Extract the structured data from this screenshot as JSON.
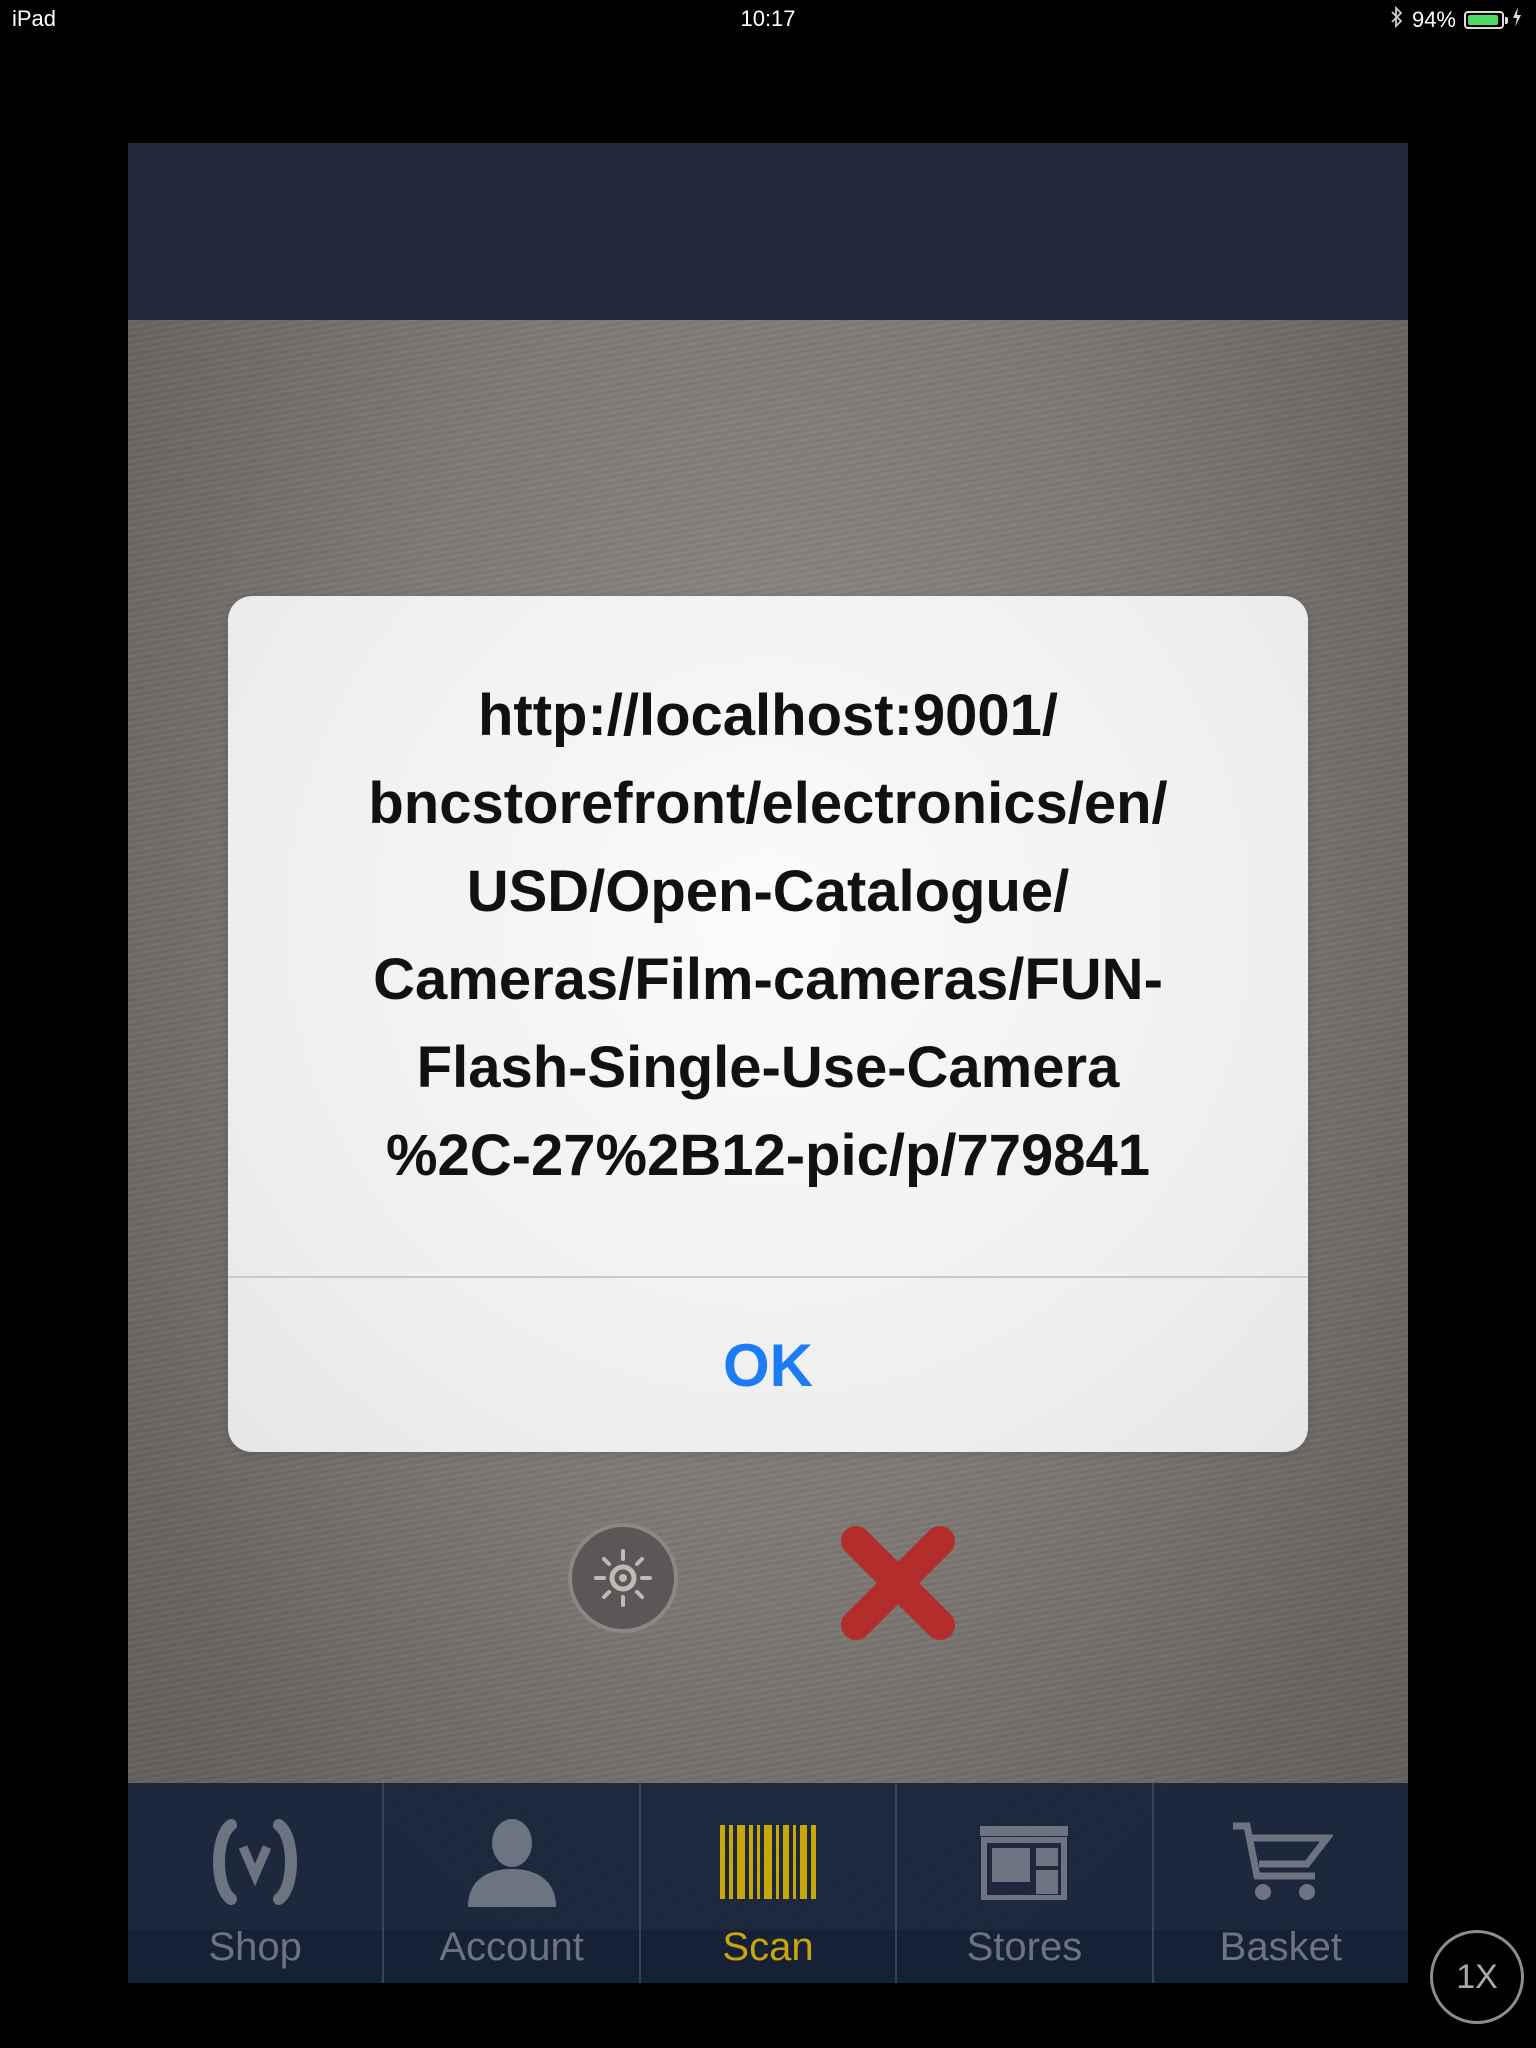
{
  "status_bar": {
    "device": "iPad",
    "time": "10:17",
    "battery_percent": "94%",
    "battery_level": 0.94
  },
  "alert": {
    "message": "http://localhost:9001/\nbncstorefront/electronics/en/\nUSD/Open-Catalogue/\nCameras/Film-cameras/FUN-\nFlash-Single-Use-Camera\n%2C-27%2B12-pic/p/779841",
    "ok_label": "OK"
  },
  "scanner": {
    "flash_icon": "flash-toggle-icon",
    "close_icon": "close-x-icon",
    "close_color": "#b42d2d"
  },
  "tab_bar": {
    "active_color": "#c8a70a",
    "items": [
      {
        "label": "Shop",
        "icon": "shop-logo-icon"
      },
      {
        "label": "Account",
        "icon": "person-icon"
      },
      {
        "label": "Scan",
        "icon": "barcode-icon"
      },
      {
        "label": "Stores",
        "icon": "store-icon"
      },
      {
        "label": "Basket",
        "icon": "cart-icon"
      }
    ]
  },
  "zoom_badge": {
    "label": "1X"
  }
}
